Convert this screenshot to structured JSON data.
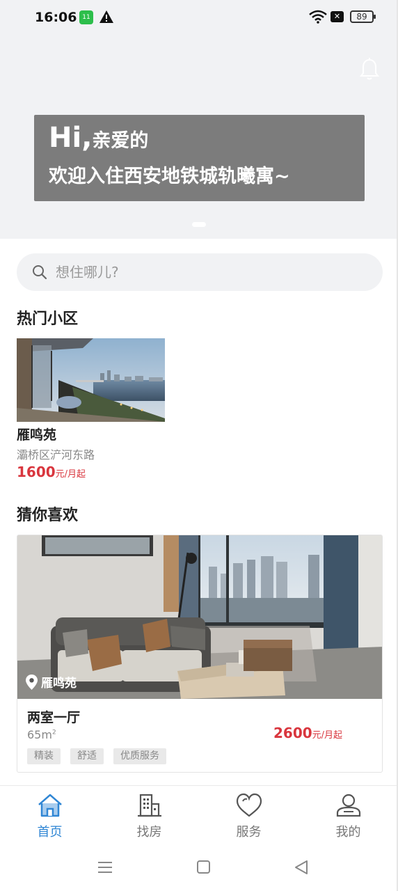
{
  "status_bar": {
    "time": "16:06",
    "battery": "89",
    "app_badge": "11",
    "icons": [
      "app-badge-icon",
      "warning-icon",
      "wifi-icon",
      "sim-off-icon",
      "battery-icon"
    ]
  },
  "banner": {
    "greeting_big": "Hi,",
    "greeting_small": "亲爱的",
    "welcome": "欢迎入住西安地铁城轨曦寓~",
    "bell_icon": "bell-icon"
  },
  "search": {
    "placeholder": "想住哪儿?"
  },
  "hot_section": {
    "title": "热门小区",
    "items": [
      {
        "name": "雁鸣苑",
        "address": "灞桥区浐河东路",
        "price": "1600",
        "price_unit": "元/月起"
      }
    ]
  },
  "guess_section": {
    "title": "猜你喜欢",
    "items": [
      {
        "location": "雁鸣苑",
        "title": "两室一厅",
        "area": "65m",
        "area_sup": "2",
        "price": "2600",
        "price_unit": "元/月起",
        "tags": [
          "精装",
          "舒适",
          "优质服务"
        ]
      }
    ]
  },
  "tab_bar": {
    "active": "home",
    "tabs": [
      {
        "label": "首页",
        "icon": "home-icon"
      },
      {
        "label": "找房",
        "icon": "building-icon"
      },
      {
        "label": "服务",
        "icon": "heart-icon"
      },
      {
        "label": "我的",
        "icon": "user-icon"
      }
    ]
  },
  "colors": {
    "accent": "#2f86d4",
    "price": "#d9363e",
    "banner_card": "#7c7c7c",
    "background": "#f1f2f4"
  }
}
